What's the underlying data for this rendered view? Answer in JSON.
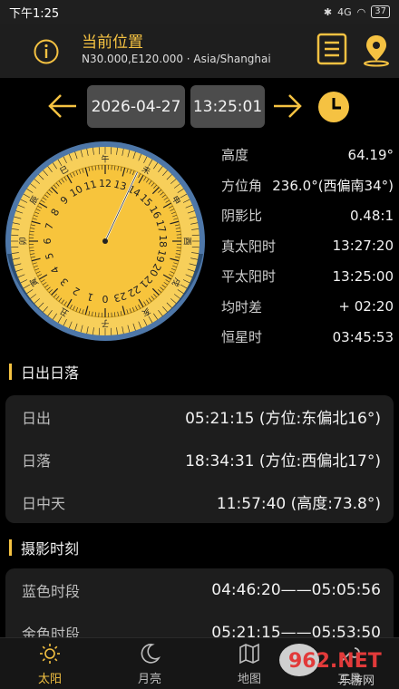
{
  "status_bar": {
    "time": "下午1:25",
    "signal": "4G",
    "battery": "37"
  },
  "header": {
    "title": "当前位置",
    "subtitle": "N30.000,E120.000 · Asia/Shanghai"
  },
  "datetime": {
    "date": "2026-04-27",
    "time": "13:25:01"
  },
  "dial": {
    "branches": [
      "午",
      "未",
      "申",
      "酉",
      "戌",
      "亥",
      "子",
      "丑",
      "寅",
      "卯",
      "辰",
      "巳"
    ],
    "hours": [
      12,
      13,
      14,
      15,
      16,
      17,
      18,
      19,
      20,
      21,
      22,
      23,
      0,
      1,
      2,
      3,
      4,
      5,
      6,
      7,
      8,
      9,
      10,
      11
    ],
    "hand_angle_deg": 25,
    "colors": {
      "face": "#f7c43c",
      "rim": "#f7cf5a",
      "sky": "#4e77a8",
      "ground": "#2c4e74",
      "ink": "#222222"
    }
  },
  "sun_data": [
    {
      "label": "高度",
      "value": "64.19°"
    },
    {
      "label": "方位角",
      "value": "236.0°(西偏南34°)"
    },
    {
      "label": "阴影比",
      "value": "0.48:1"
    },
    {
      "label": "真太阳时",
      "value": "13:27:20"
    },
    {
      "label": "平太阳时",
      "value": "13:25:00"
    },
    {
      "label": "均时差",
      "value": "+ 02:20"
    },
    {
      "label": "恒星时",
      "value": "03:45:53"
    }
  ],
  "sunrise_section": {
    "title": "日出日落",
    "rows": [
      {
        "label": "日出",
        "value": "05:21:15 (方位:东偏北16°)"
      },
      {
        "label": "日落",
        "value": "18:34:31 (方位:西偏北17°)"
      },
      {
        "label": "日中天",
        "value": "11:57:40 (高度:73.8°)"
      }
    ]
  },
  "photo_section": {
    "title": "摄影时刻",
    "rows": [
      {
        "label": "蓝色时段",
        "value": "04:46:20——05:05:56"
      },
      {
        "label": "金色时段",
        "value": "05:21:15——05:53:50"
      }
    ]
  },
  "nav": [
    {
      "label": "太阳",
      "icon": "sun-icon",
      "active": true
    },
    {
      "label": "月亮",
      "icon": "moon-icon",
      "active": false
    },
    {
      "label": "地图",
      "icon": "map-icon",
      "active": false
    },
    {
      "label": "工具",
      "icon": "tool-icon",
      "active": false
    }
  ],
  "watermark": {
    "text": "962.NET",
    "sub": "乐游网"
  },
  "accent": "#f5c242"
}
